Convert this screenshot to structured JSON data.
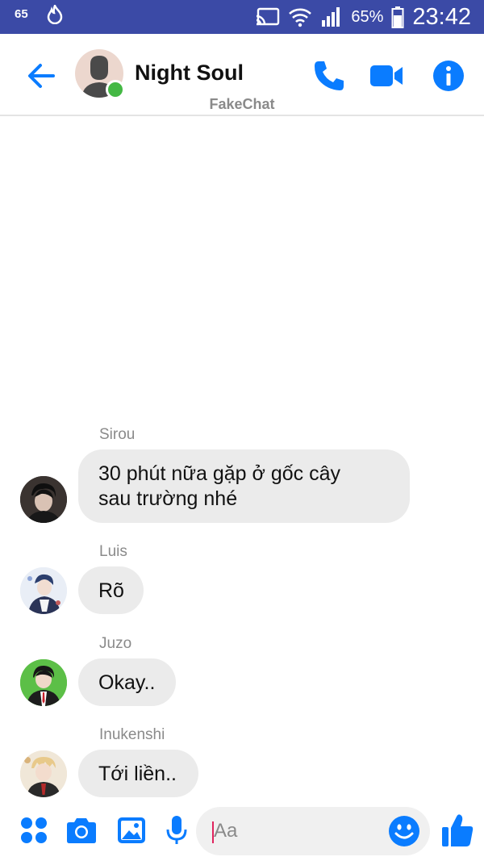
{
  "status_bar": {
    "left_badge": "65",
    "battery_percent": "65%",
    "time": "23:42",
    "icons": [
      "notification-65-icon",
      "flame-icon",
      "cast-icon",
      "wifi-icon",
      "signal-icon",
      "battery-icon"
    ]
  },
  "header": {
    "contact_name": "Night Soul",
    "sub_label": "FakeChat",
    "online": true,
    "icons": [
      "back-arrow-icon",
      "phone-icon",
      "video-camera-icon",
      "info-icon"
    ],
    "accent_color": "#0a7cff"
  },
  "messages": [
    {
      "sender": "Sirou",
      "text_lines": [
        "30 phút nữa gặp ở gốc cây",
        "sau trường nhé"
      ]
    },
    {
      "sender": "Luis",
      "text_lines": [
        "Rõ"
      ]
    },
    {
      "sender": "Juzo",
      "text_lines": [
        "Okay.."
      ]
    },
    {
      "sender": "Inukenshi",
      "text_lines": [
        "Tới liền.."
      ]
    }
  ],
  "composer": {
    "placeholder": "Aa",
    "value": "",
    "icons": [
      "apps-grid-icon",
      "camera-icon",
      "image-icon",
      "microphone-icon",
      "emoji-icon",
      "thumbs-up-icon"
    ]
  }
}
